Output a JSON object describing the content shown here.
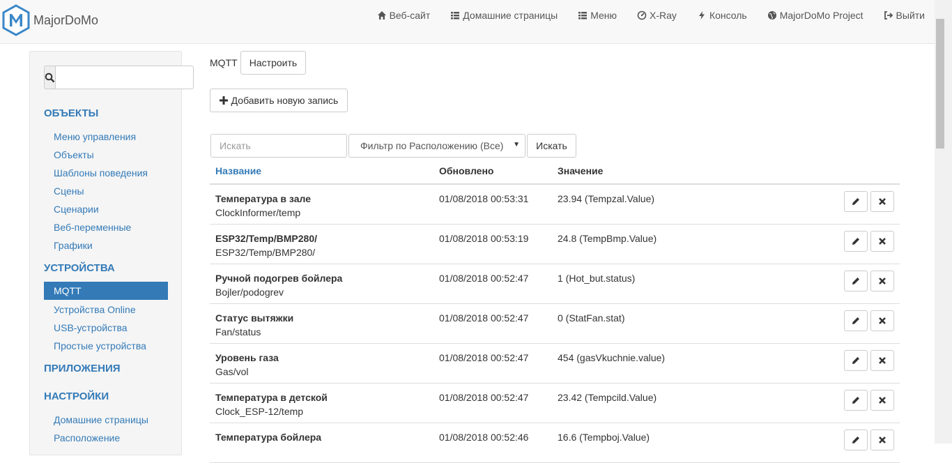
{
  "brand": {
    "name": "MajorDoMo"
  },
  "nav": [
    {
      "label": "Веб-сайт",
      "icon": "home-icon"
    },
    {
      "label": "Домашние страницы",
      "icon": "list-icon"
    },
    {
      "label": "Меню",
      "icon": "list-icon"
    },
    {
      "label": "X-Ray",
      "icon": "dashboard-icon"
    },
    {
      "label": "Консоль",
      "icon": "bolt-icon"
    },
    {
      "label": "MajorDoMo Project",
      "icon": "globe-icon"
    },
    {
      "label": "Выйти",
      "icon": "logout-icon"
    }
  ],
  "sidebar": {
    "search_placeholder": "",
    "sections": [
      {
        "header": "ОБЪЕКТЫ",
        "items": [
          "Меню управления",
          "Объекты",
          "Шаблоны поведения",
          "Сцены",
          "Сценарии",
          "Веб-переменные",
          "Графики"
        ]
      },
      {
        "header": "УСТРОЙСТВА",
        "items": [
          "MQTT",
          "Устройства Online",
          "USB-устройства",
          "Простые устройства"
        ],
        "active": "MQTT"
      },
      {
        "header": "ПРИЛОЖЕНИЯ",
        "items": []
      },
      {
        "header": "НАСТРОЙКИ",
        "items": [
          "Домашние страницы",
          "Расположение"
        ]
      }
    ]
  },
  "main": {
    "module_label": "MQTT",
    "configure_button": "Настроить",
    "add_button": "Добавить новую запись",
    "filter": {
      "search_placeholder": "Искать",
      "location_select": "Фильтр по Расположению (Все)",
      "search_button": "Искать"
    },
    "table": {
      "headers": {
        "name": "Название",
        "updated": "Обновлено",
        "value": "Значение"
      },
      "rows": [
        {
          "title": "Температура в зале",
          "topic": "ClockInformer/temp",
          "updated": "01/08/2018 00:53:31",
          "value": "23.94 (Tempzal.Value)"
        },
        {
          "title": "ESP32/Temp/BMP280/",
          "topic": "ESP32/Temp/BMP280/",
          "updated": "01/08/2018 00:53:19",
          "value": "24.8 (TempBmp.Value)"
        },
        {
          "title": "Ручной подогрев бойлера",
          "topic": "Bojler/podogrev",
          "updated": "01/08/2018 00:52:47",
          "value": "1 (Hot_but.status)"
        },
        {
          "title": "Статус вытяжки",
          "topic": "Fan/status",
          "updated": "01/08/2018 00:52:47",
          "value": "0 (StatFan.stat)"
        },
        {
          "title": "Уровень газа",
          "topic": "Gas/vol",
          "updated": "01/08/2018 00:52:47",
          "value": "454 (gasVkuchnie.value)"
        },
        {
          "title": "Температура в детской",
          "topic": "Clock_ESP-12/temp",
          "updated": "01/08/2018 00:52:47",
          "value": "23.42 (Tempcild.Value)"
        },
        {
          "title": "Температура бойлера",
          "topic": "",
          "updated": "01/08/2018 00:52:46",
          "value": "16.6 (Tempboj.Value)"
        }
      ]
    }
  },
  "colors": {
    "link": "#337ab7",
    "navbar_bg": "#f8f8f8",
    "sidebar_bg": "#f5f5f5"
  }
}
